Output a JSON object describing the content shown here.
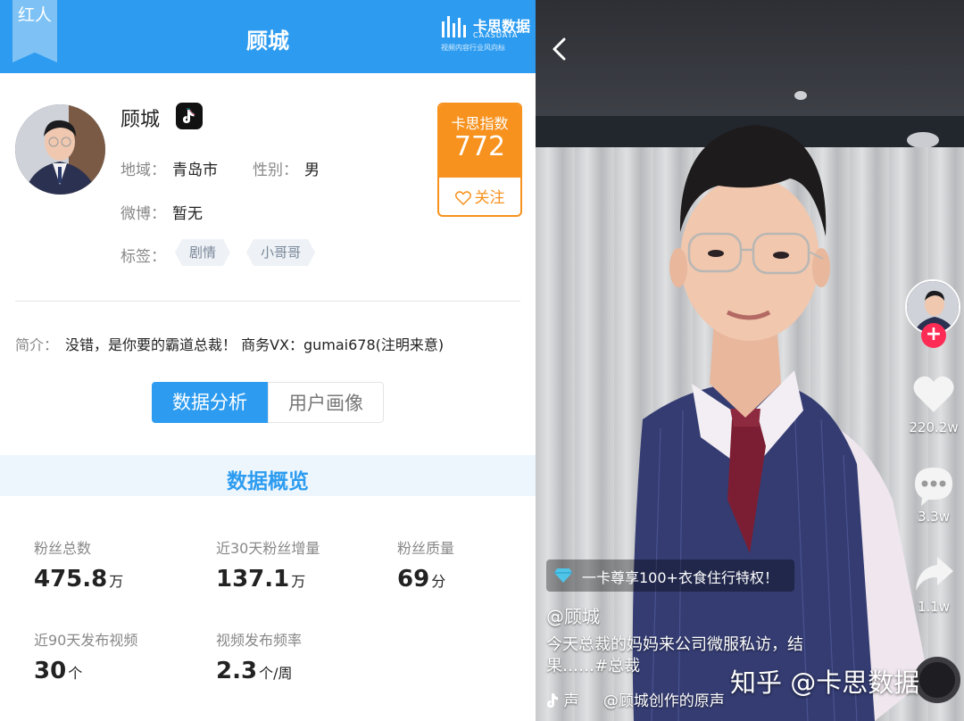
{
  "left_panel": {
    "ribbon_text": "红人",
    "header_title": "顾城",
    "brand": {
      "name": "卡思数据",
      "sub": "CAASDATA",
      "slogan": "视频内容行业风向标"
    },
    "profile": {
      "name": "顾城",
      "region_label": "地域：",
      "region_value": "青岛市",
      "gender_label": "性别：",
      "gender_value": "男",
      "weibo_label": "微博：",
      "weibo_value": "暂无",
      "tags_label": "标签：",
      "tags": [
        "剧情",
        "小哥哥"
      ]
    },
    "index": {
      "label": "卡思指数",
      "value": "772",
      "follow_label": "关注"
    },
    "intro": {
      "label": "简介：",
      "text": "没错，是你要的霸道总裁！ 商务VX：gumai678(注明来意)"
    },
    "tabs": [
      "数据分析",
      "用户画像"
    ],
    "overview_title": "数据概览",
    "stats": [
      {
        "label": "粉丝总数",
        "value": "475.8",
        "unit": "万"
      },
      {
        "label": "近30天粉丝增量",
        "value": "137.1",
        "unit": "万"
      },
      {
        "label": "粉丝质量",
        "value": "69",
        "unit": "分"
      },
      {
        "label": "近90天发布视频",
        "value": "30",
        "unit": "个"
      },
      {
        "label": "视频发布频率",
        "value": "2.3",
        "unit": "个/周"
      }
    ]
  },
  "right_panel": {
    "likes": "220.2w",
    "comments": "3.3w",
    "shares": "1.1w",
    "plus": "+",
    "promo_text": "一卡尊享100+衣食住行特权！",
    "author": "@顾城",
    "caption": "今天总裁的妈妈来公司微服私访，结果……#总裁",
    "music_prefix": "声",
    "music_text": "@顾城创作的原声",
    "watermark": "知乎 @卡思数据",
    "colors": {
      "brand_blue": "#2d9cf0",
      "index_orange": "#f7921e",
      "plus_red": "#fe2c55"
    }
  }
}
